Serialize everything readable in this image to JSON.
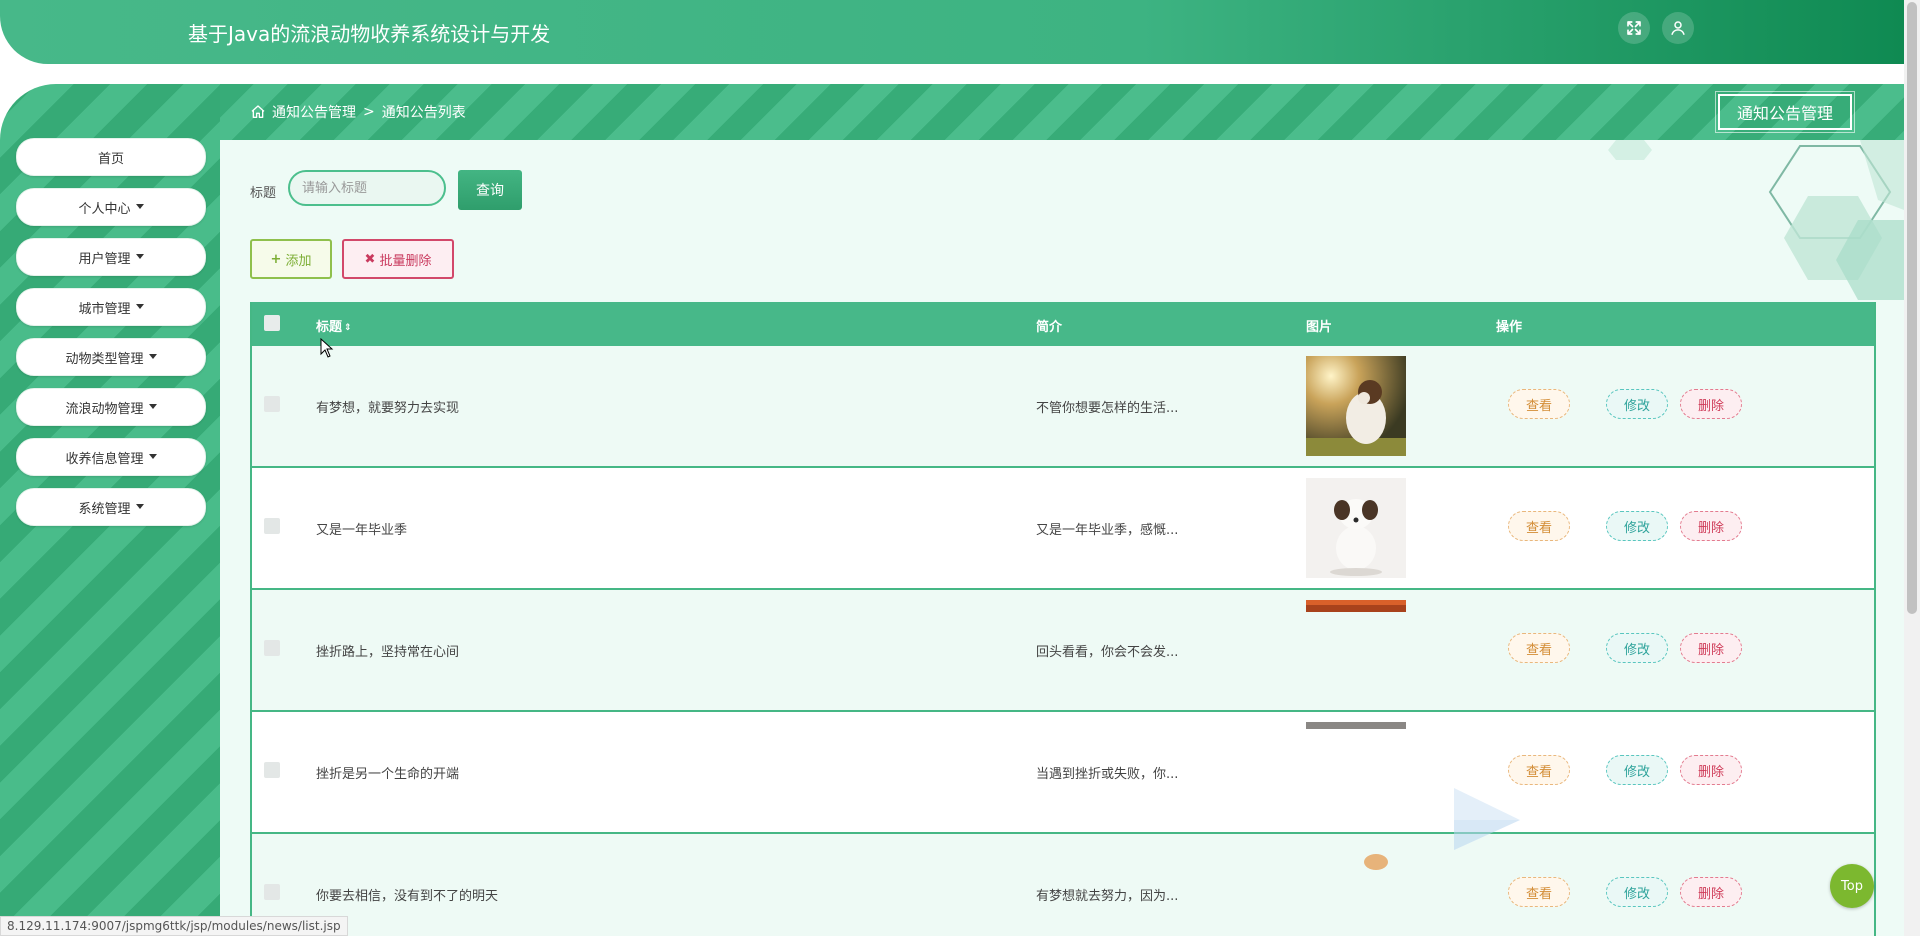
{
  "header": {
    "app_title": "基于Java的流浪动物收养系统设计与开发",
    "fullscreen_icon": "expand-icon",
    "user_icon": "user-icon"
  },
  "sidebar": {
    "items": [
      {
        "label": "首页",
        "has_dropdown": false
      },
      {
        "label": "个人中心",
        "has_dropdown": true
      },
      {
        "label": "用户管理",
        "has_dropdown": true
      },
      {
        "label": "城市管理",
        "has_dropdown": true
      },
      {
        "label": "动物类型管理",
        "has_dropdown": true
      },
      {
        "label": "流浪动物管理",
        "has_dropdown": true
      },
      {
        "label": "收养信息管理",
        "has_dropdown": true
      },
      {
        "label": "系统管理",
        "has_dropdown": true
      }
    ]
  },
  "breadcrumb": {
    "home_icon": "home-icon",
    "level1": "通知公告管理",
    "separator": ">",
    "level2": "通知公告列表"
  },
  "page_badge": "通知公告管理",
  "search": {
    "label": "标题",
    "placeholder": "请输入标题",
    "value": "",
    "button": "查询"
  },
  "toolbar": {
    "add_label": "添加",
    "batch_delete_label": "批量删除"
  },
  "table": {
    "columns": {
      "title": "标题",
      "intro": "简介",
      "image": "图片",
      "actions": "操作"
    },
    "rows": [
      {
        "title": "有梦想，就要努力去实现",
        "intro": "不管你想要怎样的生活...",
        "image": "dog-sunset"
      },
      {
        "title": "又是一年毕业季",
        "intro": "又是一年毕业季，感慨...",
        "image": "puppy-white"
      },
      {
        "title": "挫折路上，坚持常在心间",
        "intro": "回头看看，你会不会发...",
        "image": "partial-orange"
      },
      {
        "title": "挫折是另一个生命的开端",
        "intro": "当遇到挫折或失败，你...",
        "image": "partial-gray"
      },
      {
        "title": "你要去相信，没有到不了的明天",
        "intro": "有梦想就去努力，因为...",
        "image": "partial-cat"
      }
    ],
    "actions": {
      "view": "查看",
      "edit": "修改",
      "delete": "删除"
    }
  },
  "top_button": "Top",
  "status_url": "8.129.11.174:9007/jspmg6ttk/jsp/modules/news/list.jsp",
  "colors": {
    "primary": "#47b889",
    "primary_dark": "#2f9e6c",
    "add": "#7cae34",
    "danger": "#c93a5e",
    "view": "#d38d36",
    "edit": "#2ea39b"
  }
}
